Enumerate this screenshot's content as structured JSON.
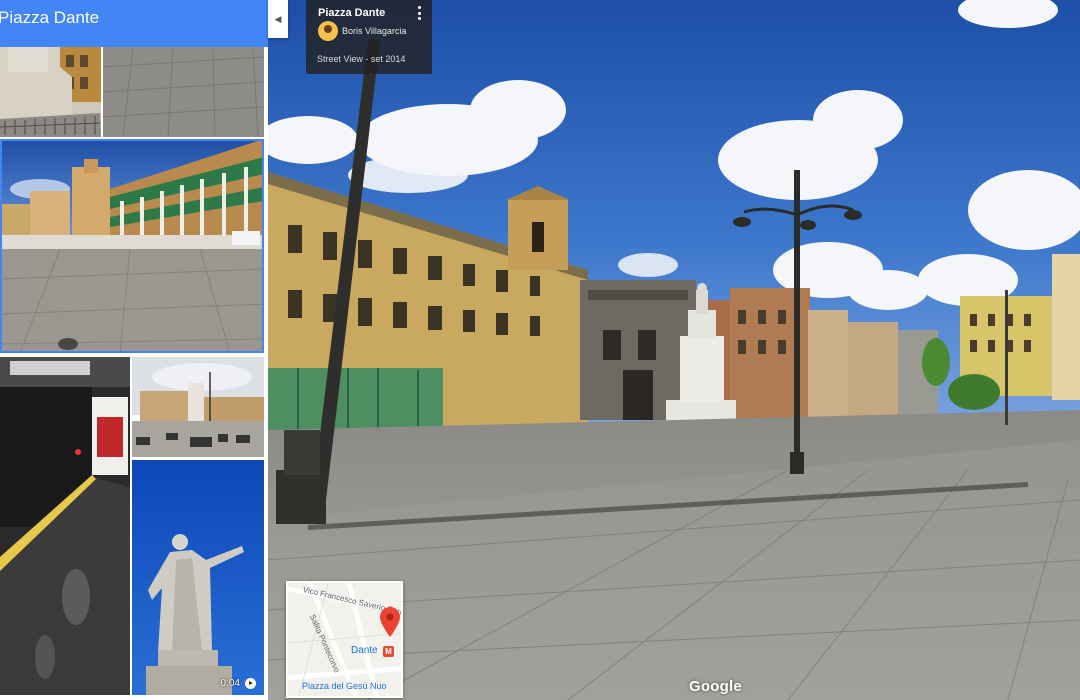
{
  "sidebar": {
    "title": "Piazza Dante",
    "thumbnails": [
      {
        "name": "thumb-monument-base"
      },
      {
        "name": "thumb-pavement"
      },
      {
        "name": "thumb-piazza-wide"
      },
      {
        "name": "thumb-metro-station"
      },
      {
        "name": "thumb-piazza-small"
      },
      {
        "name": "thumb-dante-statue",
        "video_duration": "0:04"
      }
    ]
  },
  "collapse_icon": "chevron-left-icon",
  "info_card": {
    "title": "Piazza Dante",
    "author": "Boris Villagarcia",
    "date": "Street View - set 2014",
    "menu_icon": "more-vert-icon"
  },
  "minimap": {
    "street1": "Vico Francesco Saverio Correra",
    "street2": "Salita Pontecorvo",
    "place": "Dante",
    "place2": "Piazza del Gesù Nuo",
    "pin_color": "#ea4335",
    "metro_badge": "M"
  },
  "brand": "Google",
  "colors": {
    "accent": "#4285f4",
    "sky": "#2f63b8"
  }
}
